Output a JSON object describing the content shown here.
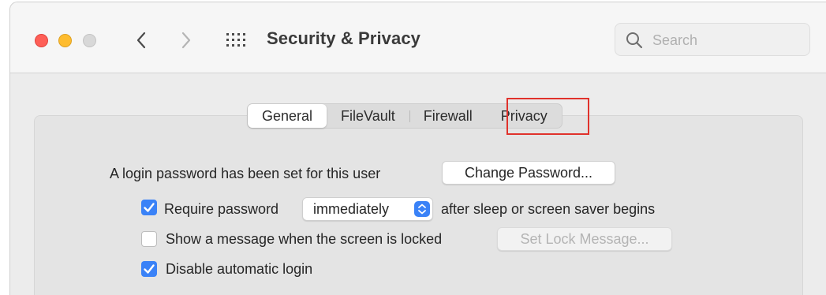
{
  "window": {
    "title": "Security & Privacy",
    "search_placeholder": "Search"
  },
  "tabs": [
    {
      "label": "General",
      "active": true
    },
    {
      "label": "FileVault",
      "active": false
    },
    {
      "label": "Firewall",
      "active": false
    },
    {
      "label": "Privacy",
      "active": false
    }
  ],
  "general": {
    "login_password_text": "A login password has been set for this user",
    "change_password_label": "Change Password...",
    "require_password": {
      "checked": true,
      "label": "Require password",
      "select_value": "immediately",
      "suffix": "after sleep or screen saver begins"
    },
    "show_message": {
      "checked": false,
      "label": "Show a message when the screen is locked",
      "button_label": "Set Lock Message..."
    },
    "disable_auto_login": {
      "checked": true,
      "label": "Disable automatic login"
    }
  },
  "colors": {
    "accent": "#3a82f7",
    "highlight": "#e0322c"
  }
}
